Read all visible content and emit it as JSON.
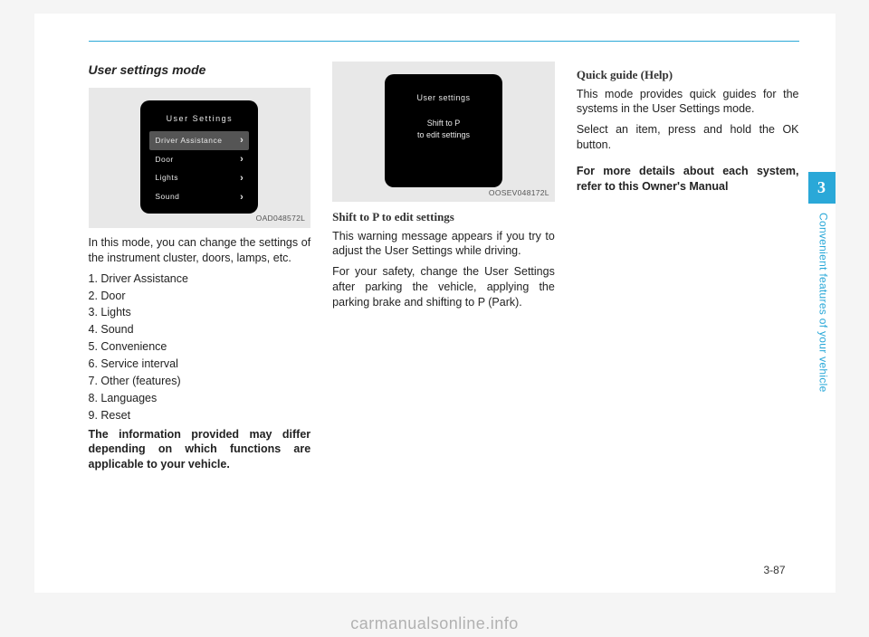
{
  "header": {
    "sectionTitle": "User settings mode"
  },
  "col1": {
    "figure": {
      "screenTitle": "User Settings",
      "menu": [
        {
          "label": "Driver Assistance",
          "selected": true
        },
        {
          "label": "Door",
          "selected": false
        },
        {
          "label": "Lights",
          "selected": false
        },
        {
          "label": "Sound",
          "selected": false
        }
      ],
      "caption": "OAD048572L"
    },
    "intro": "In this mode, you can change the settings of the instrument cluster, doors, lamps, etc.",
    "items": [
      "1. Driver Assistance",
      "2. Door",
      "3. Lights",
      "4. Sound",
      "5. Convenience",
      "6. Service interval",
      "7. Other (features)",
      "8. Languages",
      "9. Reset"
    ],
    "note": "The information provided may differ depending on which functions are applicable to your vehicle."
  },
  "col2": {
    "figure": {
      "screenTitle": "User settings",
      "msgLine1": "Shift to P",
      "msgLine2": "to edit settings",
      "caption": "OOSEV048172L"
    },
    "subhead": "Shift to P to edit settings",
    "p1": "This warning message appears if you try to adjust the User Settings while driving.",
    "p2": "For your safety, change the User Settings after parking the vehicle, applying the parking brake and shifting to P (Park)."
  },
  "col3": {
    "subhead": "Quick guide (Help)",
    "p1": "This mode provides quick guides for the systems in the User Settings mode.",
    "p2": "Select an item, press and hold the OK button.",
    "note": "For more details about each system, refer to this Owner's Manual"
  },
  "side": {
    "chapterNum": "3",
    "chapterLabel": "Convenient features of your vehicle"
  },
  "pageNum": "3-87",
  "watermark": "carmanualsonline.info"
}
